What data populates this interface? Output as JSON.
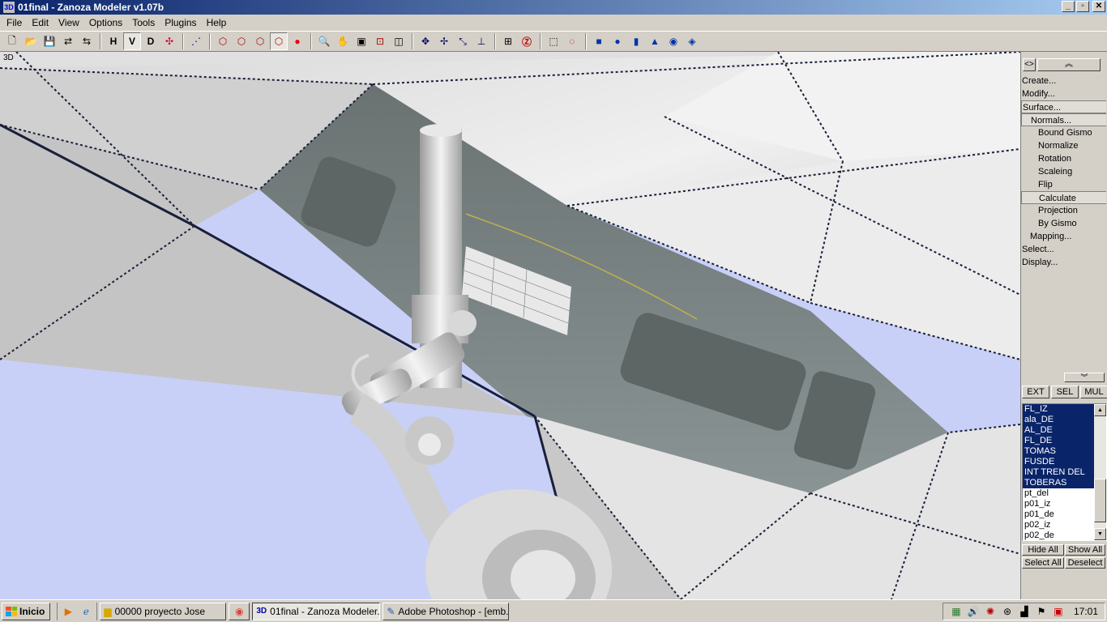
{
  "window": {
    "title": "01final - Zanoza Modeler v1.07b",
    "app_icon_text": "3D",
    "minimize": "_",
    "maximize": "▫",
    "close": "✕"
  },
  "menu": [
    "File",
    "Edit",
    "View",
    "Options",
    "Tools",
    "Plugins",
    "Help"
  ],
  "toolbar": {
    "h_label": "H",
    "v_label": "V",
    "d_label": "D"
  },
  "viewport": {
    "label": "3D"
  },
  "panel": {
    "top_left_button": "<>",
    "top_right_button": "︽",
    "scroll_down_button": "︾",
    "tree": [
      {
        "label": "Create...",
        "level": 0
      },
      {
        "label": "Modify...",
        "level": 0
      },
      {
        "label": "Surface...",
        "level": 0,
        "boxed": true
      },
      {
        "label": "Normals...",
        "level": 1,
        "boxed": true
      },
      {
        "label": "Bound Gismo",
        "level": 2
      },
      {
        "label": "Normalize",
        "level": 2
      },
      {
        "label": "Rotation",
        "level": 2
      },
      {
        "label": "Scaleing",
        "level": 2
      },
      {
        "label": "Flip",
        "level": 2
      },
      {
        "label": "Calculate",
        "level": 2,
        "boxed": true
      },
      {
        "label": "Projection",
        "level": 2
      },
      {
        "label": "By Gismo",
        "level": 2
      },
      {
        "label": "Mapping...",
        "level": 1
      },
      {
        "label": "Select...",
        "level": 0
      },
      {
        "label": "Display...",
        "level": 0
      }
    ],
    "modes": [
      "EXT",
      "SEL",
      "MUL"
    ],
    "objects": [
      {
        "name": "FL_IZ",
        "selected": true
      },
      {
        "name": "ala_DE",
        "selected": true
      },
      {
        "name": "AL_DE",
        "selected": true
      },
      {
        "name": "FL_DE",
        "selected": true
      },
      {
        "name": "TOMAS",
        "selected": true
      },
      {
        "name": "FUSDE",
        "selected": true
      },
      {
        "name": "INT TREN DEL",
        "selected": true
      },
      {
        "name": "TOBERAS",
        "selected": true
      },
      {
        "name": "pt_del",
        "selected": false
      },
      {
        "name": "p01_iz",
        "selected": false
      },
      {
        "name": "p01_de",
        "selected": false
      },
      {
        "name": "p02_iz",
        "selected": false
      },
      {
        "name": "p02_de",
        "selected": false
      }
    ],
    "hide_all": "Hide All",
    "show_all": "Show All",
    "select_all": "Select All",
    "deselect": "Deselect"
  },
  "taskbar": {
    "start": "Inicio",
    "tasks": [
      {
        "label": "00000 proyecto Jose",
        "icon": "folder-icon"
      },
      {
        "label": "01final - Zanoza Modeler...",
        "icon": "zanoza-icon",
        "active": true
      },
      {
        "label": "Adobe Photoshop - [emb...",
        "icon": "photoshop-icon"
      }
    ],
    "clock": "17:01"
  }
}
